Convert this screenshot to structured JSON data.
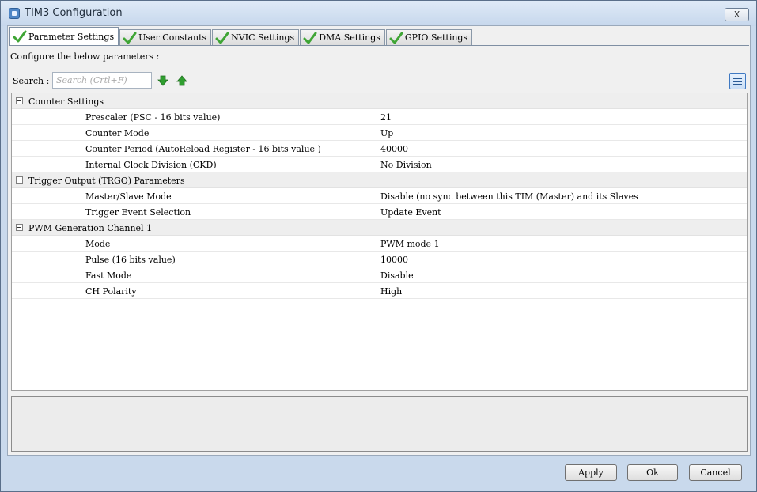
{
  "window": {
    "title": "TIM3 Configuration",
    "close_label": "X"
  },
  "tabs": [
    {
      "label": "Parameter Settings",
      "active": true
    },
    {
      "label": "User Constants",
      "active": false
    },
    {
      "label": "NVIC Settings",
      "active": false
    },
    {
      "label": "DMA Settings",
      "active": false
    },
    {
      "label": "GPIO Settings",
      "active": false
    }
  ],
  "panel": {
    "description": "Configure the below parameters :",
    "search_label": "Search :",
    "search_placeholder": "Search (Crtl+F)"
  },
  "groups": [
    {
      "title": "Counter Settings",
      "params": [
        {
          "name": "Prescaler (PSC - 16 bits value)",
          "value": "21"
        },
        {
          "name": "Counter Mode",
          "value": "Up"
        },
        {
          "name": "Counter Period (AutoReload Register - 16 bits value )",
          "value": "40000"
        },
        {
          "name": "Internal Clock Division (CKD)",
          "value": "No Division"
        }
      ]
    },
    {
      "title": "Trigger Output (TRGO) Parameters",
      "params": [
        {
          "name": "Master/Slave Mode",
          "value": "Disable (no sync between this TIM (Master) and its Slaves"
        },
        {
          "name": "Trigger Event Selection",
          "value": "Update Event"
        }
      ]
    },
    {
      "title": "PWM Generation Channel 1",
      "params": [
        {
          "name": "Mode",
          "value": "PWM mode 1"
        },
        {
          "name": "Pulse (16 bits value)",
          "value": "10000"
        },
        {
          "name": "Fast Mode",
          "value": "Disable"
        },
        {
          "name": "CH Polarity",
          "value": "High"
        }
      ]
    }
  ],
  "footer": {
    "apply_label": "Apply",
    "ok_label": "Ok",
    "cancel_label": "Cancel"
  },
  "icons": {
    "tab_check": "check-icon",
    "search_next": "arrow-down-icon",
    "search_prev": "arrow-up-icon",
    "view_toggle": "list-view-icon"
  },
  "colors": {
    "check_green": "#3fa535",
    "arrow_green": "#2f9e2f"
  }
}
